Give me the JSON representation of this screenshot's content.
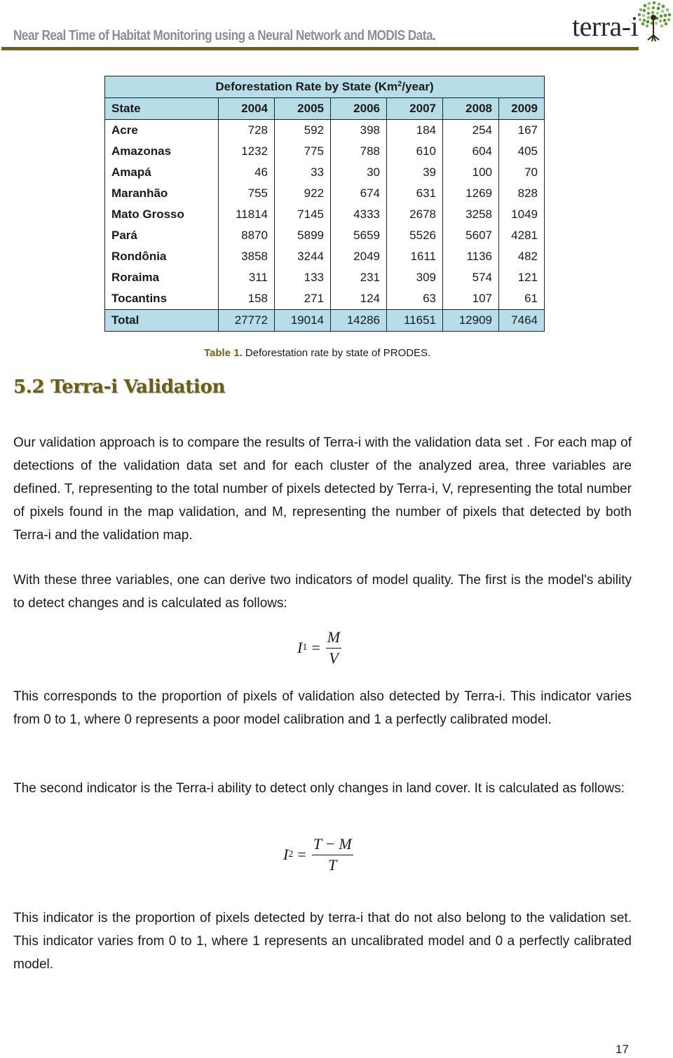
{
  "running_header": {
    "title": "Near Real Time of Habitat Monitoring using a Neural Network and MODIS Data.",
    "logo_text": "terra-i",
    "logo_icon": "tree-icon",
    "rule_color": "#6b5f12"
  },
  "table": {
    "title_prefix": "Deforestation Rate by State (Km",
    "title_sup": "2",
    "title_suffix": "/year)",
    "columns": [
      "State",
      "2004",
      "2005",
      "2006",
      "2007",
      "2008",
      "2009"
    ],
    "rows": [
      [
        "Acre",
        "728",
        "592",
        "398",
        "184",
        "254",
        "167"
      ],
      [
        "Amazonas",
        "1232",
        "775",
        "788",
        "610",
        "604",
        "405"
      ],
      [
        "Amapá",
        "46",
        "33",
        "30",
        "39",
        "100",
        "70"
      ],
      [
        "Maranhão",
        "755",
        "922",
        "674",
        "631",
        "1269",
        "828"
      ],
      [
        "Mato Grosso",
        "11814",
        "7145",
        "4333",
        "2678",
        "3258",
        "1049"
      ],
      [
        "Pará",
        "8870",
        "5899",
        "5659",
        "5526",
        "5607",
        "4281"
      ],
      [
        "Rondônia",
        "3858",
        "3244",
        "2049",
        "1611",
        "1136",
        "482"
      ],
      [
        "Roraima",
        "311",
        "133",
        "231",
        "309",
        "574",
        "121"
      ],
      [
        "Tocantins",
        "158",
        "271",
        "124",
        "63",
        "107",
        "61"
      ]
    ],
    "total": [
      "Total",
      "27772",
      "19014",
      "14286",
      "11651",
      "12909",
      "7464"
    ],
    "header_fill": "#b7dde8",
    "caption_label": "Table 1.",
    "caption_text": " Deforestation rate by state of PRODES."
  },
  "section": {
    "heading": "5.2 Terra-i Validation",
    "heading_color": "#6b5f12"
  },
  "paragraphs": [
    "Our validation approach is to compare the results of Terra-i with the validation data set . For each map of detections of the validation data set and for each cluster of the analyzed area, three variables are defined. T, representing to the total number of pixels detected by Terra-i, V, representing the total number of pixels found in the map validation, and M, representing the number of pixels that detected by both Terra-i and the validation map.",
    "With these three variables, one can derive two indicators of model quality. The first is the model's ability to detect changes and is calculated as follows:",
    "This corresponds to the proportion of pixels of validation also detected by Terra-i. This indicator varies from 0 to 1, where 0 represents a poor model calibration and 1 a perfectly calibrated model.",
    "The second indicator is the Terra-i ability to detect only changes in land cover. It is calculated as follows:",
    "This indicator is the proportion of pixels detected by terra-i that do not also belong to the validation set. This indicator varies from 0 to 1, where 1 represents an uncalibrated model and 0 a perfectly calibrated model."
  ],
  "formulas": {
    "i1": {
      "symbol": "I",
      "subscript": "1",
      "equals": "=",
      "numerator": "M",
      "denominator": "V"
    },
    "i2": {
      "symbol": "I",
      "subscript": "2",
      "equals": "=",
      "numerator_left": "T",
      "numerator_op": "−",
      "numerator_right": "M",
      "denominator": "T"
    }
  },
  "page_number": "17"
}
